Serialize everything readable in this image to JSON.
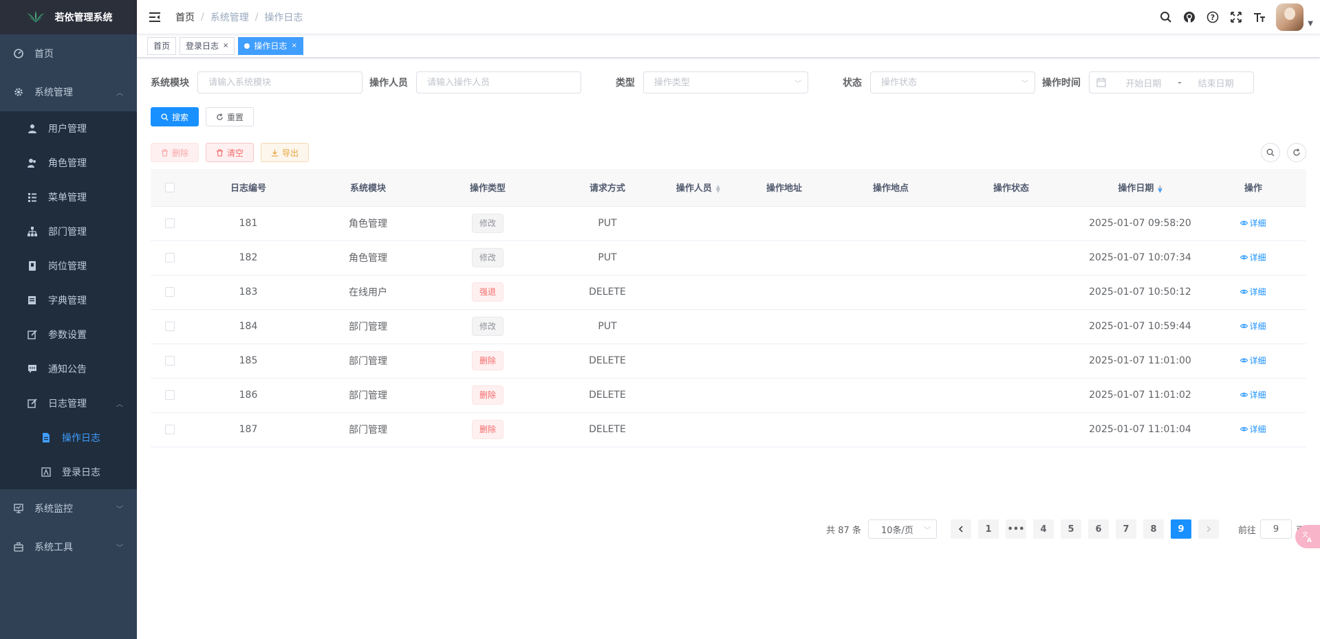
{
  "app": {
    "title": "若依管理系统"
  },
  "sidebar": {
    "home": "首页",
    "system": "系统管理",
    "system_items": [
      "用户管理",
      "角色管理",
      "菜单管理",
      "部门管理",
      "岗位管理",
      "字典管理",
      "参数设置",
      "通知公告"
    ],
    "log": "日志管理",
    "log_items": [
      "操作日志",
      "登录日志"
    ],
    "monitor": "系统监控",
    "tools": "系统工具"
  },
  "breadcrumb": [
    "首页",
    "系统管理",
    "操作日志"
  ],
  "tags": [
    "首页",
    "登录日志",
    "操作日志"
  ],
  "search": {
    "module_label": "系统模块",
    "module_placeholder": "请输入系统模块",
    "operator_label": "操作人员",
    "operator_placeholder": "请输入操作人员",
    "type_label": "类型",
    "type_placeholder": "操作类型",
    "status_label": "状态",
    "status_placeholder": "操作状态",
    "time_label": "操作时间",
    "start_placeholder": "开始日期",
    "range_sep": "-",
    "end_placeholder": "结束日期",
    "search_btn": "搜索",
    "reset_btn": "重置"
  },
  "toolbar": {
    "delete": "删除",
    "clear": "清空",
    "export": "导出"
  },
  "table": {
    "headers": [
      "日志编号",
      "系统模块",
      "操作类型",
      "请求方式",
      "操作人员",
      "操作地址",
      "操作地点",
      "操作状态",
      "操作日期",
      "操作"
    ],
    "detail_label": "详细",
    "rows": [
      {
        "id": "181",
        "module": "角色管理",
        "type": "修改",
        "type_style": "info",
        "method": "PUT",
        "date": "2025-01-07 09:58:20"
      },
      {
        "id": "182",
        "module": "角色管理",
        "type": "修改",
        "type_style": "info",
        "method": "PUT",
        "date": "2025-01-07 10:07:34"
      },
      {
        "id": "183",
        "module": "在线用户",
        "type": "强退",
        "type_style": "danger",
        "method": "DELETE",
        "date": "2025-01-07 10:50:12"
      },
      {
        "id": "184",
        "module": "部门管理",
        "type": "修改",
        "type_style": "info",
        "method": "PUT",
        "date": "2025-01-07 10:59:44"
      },
      {
        "id": "185",
        "module": "部门管理",
        "type": "删除",
        "type_style": "danger",
        "method": "DELETE",
        "date": "2025-01-07 11:01:00"
      },
      {
        "id": "186",
        "module": "部门管理",
        "type": "删除",
        "type_style": "danger",
        "method": "DELETE",
        "date": "2025-01-07 11:01:02"
      },
      {
        "id": "187",
        "module": "部门管理",
        "type": "删除",
        "type_style": "danger",
        "method": "DELETE",
        "date": "2025-01-07 11:01:04"
      }
    ]
  },
  "pagination": {
    "total": "共 87 条",
    "page_size": "10条/页",
    "pages": [
      "1",
      "•••",
      "4",
      "5",
      "6",
      "7",
      "8",
      "9"
    ],
    "current": "9",
    "goto_label": "前往",
    "goto_value": "9",
    "page_suffix": "页"
  },
  "colors": {
    "primary": "#1890ff",
    "sidebar_bg": "#304156",
    "submenu_bg": "#1f2d3d",
    "danger": "#f56c6c",
    "warning": "#e6a23c"
  }
}
